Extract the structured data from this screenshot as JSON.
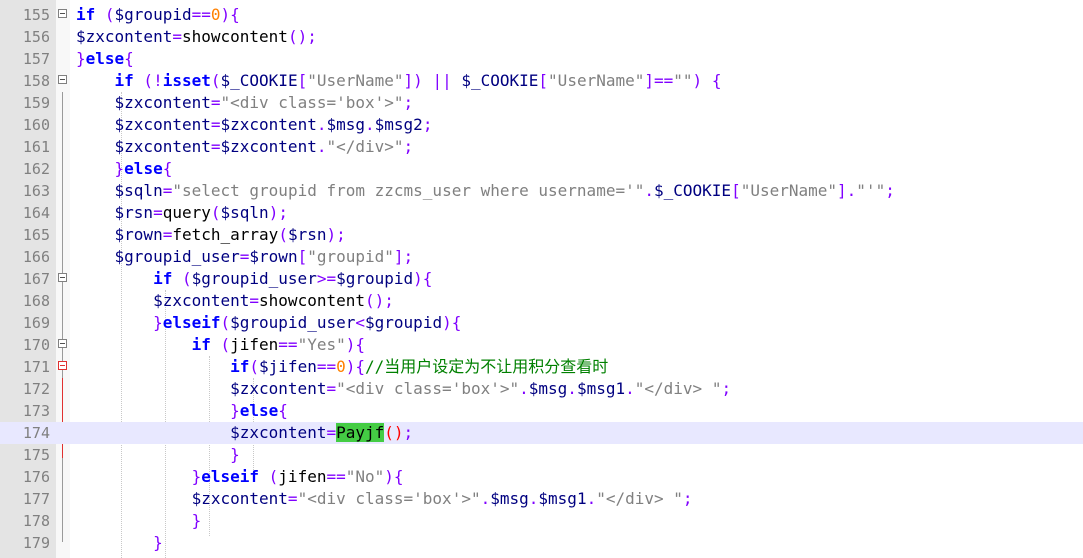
{
  "editor": {
    "line_numbers": [
      "155",
      "156",
      "157",
      "158",
      "159",
      "160",
      "161",
      "162",
      "163",
      "164",
      "165",
      "166",
      "167",
      "168",
      "169",
      "170",
      "171",
      "172",
      "173",
      "174",
      "175",
      "176",
      "177",
      "178",
      "179"
    ],
    "current_line": "174"
  },
  "code": {
    "l155": [
      "if",
      " (",
      "$groupid",
      "==",
      "0",
      "){"
    ],
    "l156": [
      "$zxcontent",
      "=",
      "showcontent",
      "();"
    ],
    "l157": [
      "}",
      "else",
      "{"
    ],
    "l158": [
      "if",
      " (",
      "!",
      "isset",
      "(",
      "$_COOKIE",
      "[",
      "\"UserName\"",
      "])",
      " || ",
      "$_COOKIE",
      "[",
      "\"UserName\"",
      "]==",
      "\"\"",
      ")",
      " {"
    ],
    "l159": [
      "$zxcontent",
      "=",
      "\"<div class='box'>\"",
      ";"
    ],
    "l160": [
      "$zxcontent",
      "=",
      "$zxcontent",
      ".",
      "$msg",
      ".",
      "$msg2",
      ";"
    ],
    "l161": [
      "$zxcontent",
      "=",
      "$zxcontent",
      ".",
      "\"</div>\"",
      ";"
    ],
    "l162": [
      "}",
      "else",
      "{"
    ],
    "l163": [
      "$sqln",
      "=",
      "\"select groupid from zzcms_user where username='\"",
      ".",
      "$_COOKIE",
      "[",
      "\"UserName\"",
      "].",
      "\"'\"",
      ";"
    ],
    "l164": [
      "$rsn",
      "=",
      "query",
      "(",
      "$sqln",
      ");"
    ],
    "l165": [
      "$rown",
      "=",
      "fetch_array",
      "(",
      "$rsn",
      ");"
    ],
    "l166": [
      "$groupid_user",
      "=",
      "$rown",
      "[",
      "\"groupid\"",
      "];"
    ],
    "l167": [
      "if",
      " (",
      "$groupid_user",
      ">=",
      "$groupid",
      "){"
    ],
    "l168": [
      "$zxcontent",
      "=",
      "showcontent",
      "();"
    ],
    "l169": [
      "}",
      "elseif",
      "(",
      "$groupid_user",
      "<",
      "$groupid",
      "){"
    ],
    "l170": [
      "if",
      " (",
      "jifen",
      "==",
      "\"Yes\"",
      "){"
    ],
    "l171": [
      "if",
      "(",
      "$jifen",
      "==",
      "0",
      "){",
      "//当用户设定为不让用积分查看时"
    ],
    "l172": [
      "$zxcontent",
      "=",
      "\"<div class='box'>\"",
      ".",
      "$msg",
      ".",
      "$msg1",
      ".",
      "\"</div> \"",
      ";"
    ],
    "l173": [
      "}",
      "else",
      "{"
    ],
    "l174": [
      "$zxcontent",
      "=",
      "Payjf",
      "(",
      ")",
      ";"
    ],
    "l175": [
      "}"
    ],
    "l176": [
      "}",
      "elseif",
      " (",
      "jifen",
      "==",
      "\"No\"",
      "){"
    ],
    "l177": [
      "$zxcontent",
      "=",
      "\"<div class='box'>\"",
      ".",
      "$msg",
      ".",
      "$msg1",
      ".",
      "\"</div> \"",
      ";"
    ],
    "l178": [
      "}"
    ],
    "l179": [
      "}"
    ]
  },
  "colors": {
    "keyword": "#0000ff",
    "variable": "#000080",
    "operator": "#8000ff",
    "string": "#808080",
    "number": "#ff8000",
    "comment": "#008000",
    "brace_match_bg": "#44cc44",
    "current_line_bg": "#e8e8ff",
    "gutter_bg": "#e4e4e4"
  }
}
